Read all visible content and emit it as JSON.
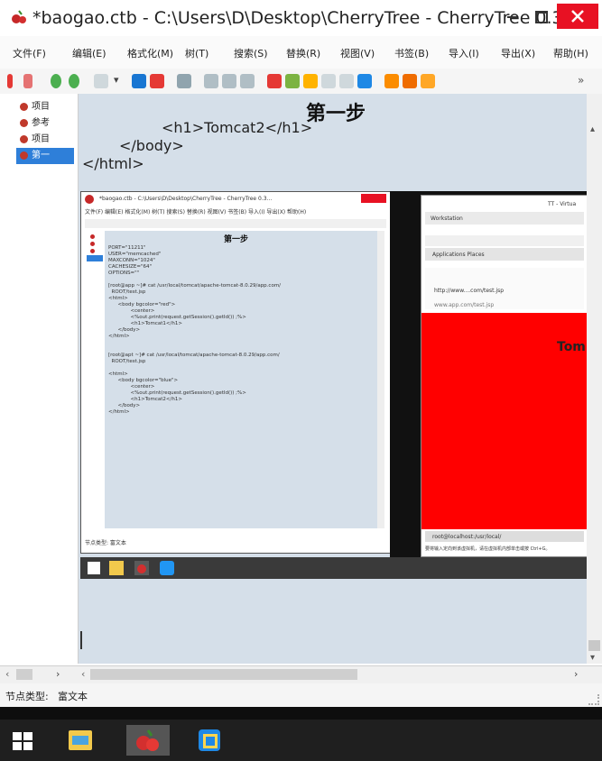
{
  "window": {
    "title": "*baogao.ctb - C:\\Users\\D\\Desktop\\CherryTree - CherryTree 0.3...",
    "close_color": "#e81123"
  },
  "menu": [
    "文件(F)",
    "编辑(E)",
    "格式化(M)",
    "树(T)",
    "搜索(S)",
    "替换(R)",
    "视图(V)",
    "书签(B)",
    "导入(I)",
    "导出(X)",
    "帮助(H)"
  ],
  "tree": {
    "items": [
      {
        "label": "项目"
      },
      {
        "label": "参考"
      },
      {
        "label": "项目"
      },
      {
        "label": "第一"
      }
    ]
  },
  "editor": {
    "heading": "第一步",
    "line1": "<h1>Tomcat2</h1>",
    "line2": "</body>",
    "line3": "</html>"
  },
  "screenshot1": {
    "title": "*baogao.ctb - C:\\Users\\D\\Desktop\\CherryTree - CherryTree 0.3...",
    "menu": "文件(F) 编辑(E) 格式化(M) 树(T) 搜索(S) 替换(R) 视图(V) 书签(B) 导入(I) 导出(X) 帮助(H)",
    "heading": "第一步",
    "code": "PORT=\"11211\"\nUSER=\"memcached\"\nMAXCONN=\"1024\"\nCACHESIZE=\"64\"\nOPTIONS=\"\"\n\n[root@app ~]# cat /usr/local/tomcat/apache-tomcat-8.0.29/app.com/\n  ROOT/test.jsp\n<html>\n      <body bgcolor=\"red\">\n              <center>\n              <%out.print(request.getSession().getId()) ;%>\n              <h1>Tomcat1</h1>\n      </body>\n</html>\n\n\n[root@apt ~]# cat /usr/local/tomcat/apache-tomcat-8.0.29/app.com/\n  ROOT/test.jsp\n\n<html>\n      <body bgcolor=\"blue\">\n              <center>\n              <%out.print(request.getSession().getId()) ;%>\n              <h1>Tomcat2</h1>\n      </body>\n</html>",
    "status": "节点类型: 富文本"
  },
  "screenshot2": {
    "title": "TT - Virtua",
    "tab_label": "Workstation",
    "address": "http://www....com/test.jsp",
    "addr2": "www.app.com/test.jsp",
    "apps": "Applications  Places",
    "red_text": "Tom",
    "status_left": "root@localhost:/usr/local/",
    "status_bottom": "要将输入定向到该虚拟机，请在虚拟机内部单击或按 Ctrl+G。"
  },
  "status": {
    "node_type_label": "节点类型:",
    "node_type_value": "富文本"
  }
}
